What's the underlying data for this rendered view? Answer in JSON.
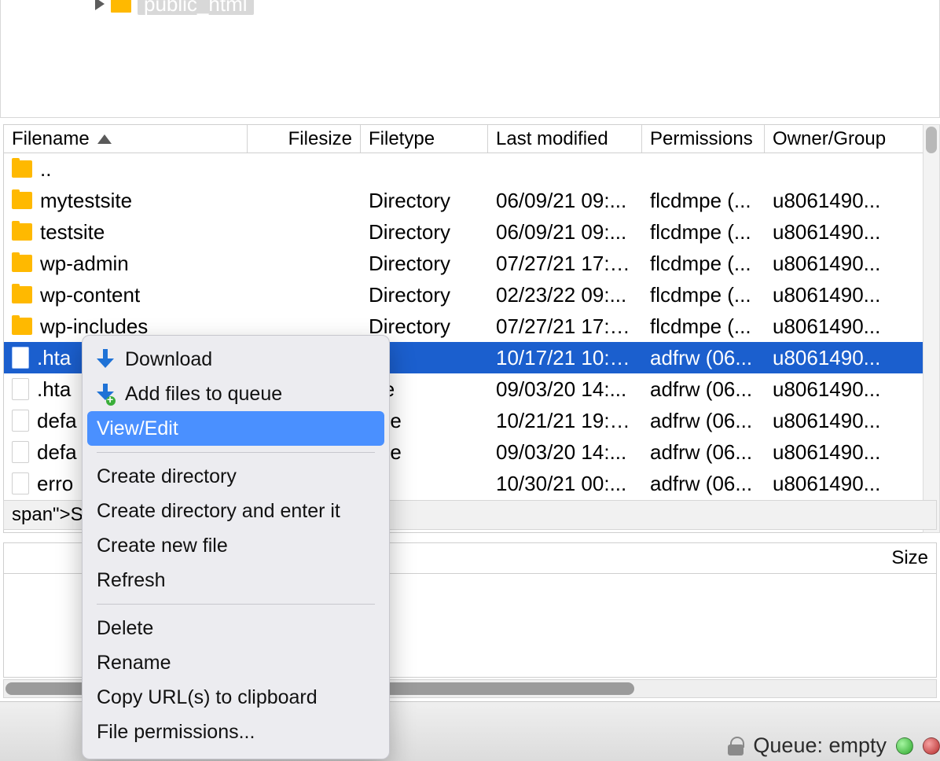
{
  "tree": {
    "selected_folder": "public_html"
  },
  "columns": {
    "filename": "Filename",
    "filesize": "Filesize",
    "filetype": "Filetype",
    "lastmod": "Last modified",
    "permissions": "Permissions",
    "owner": "Owner/Group",
    "lower_size": "Size"
  },
  "rows": [
    {
      "icon": "folder",
      "name": "..",
      "size": "",
      "type": "",
      "date": "",
      "perm": "",
      "own": "",
      "selected": false
    },
    {
      "icon": "folder",
      "name": "mytestsite",
      "size": "",
      "type": "Directory",
      "date": "06/09/21 09:...",
      "perm": "flcdmpe (...",
      "own": "u8061490...",
      "selected": false
    },
    {
      "icon": "folder",
      "name": "testsite",
      "size": "",
      "type": "Directory",
      "date": "06/09/21 09:...",
      "perm": "flcdmpe (...",
      "own": "u8061490...",
      "selected": false
    },
    {
      "icon": "folder",
      "name": "wp-admin",
      "size": "",
      "type": "Directory",
      "date": "07/27/21 17:4...",
      "perm": "flcdmpe (...",
      "own": "u8061490...",
      "selected": false
    },
    {
      "icon": "folder",
      "name": "wp-content",
      "size": "",
      "type": "Directory",
      "date": "02/23/22 09:...",
      "perm": "flcdmpe (...",
      "own": "u8061490...",
      "selected": false
    },
    {
      "icon": "folder",
      "name": "wp-includes",
      "size": "",
      "type": "Directory",
      "date": "07/27/21 17:4...",
      "perm": "flcdmpe (...",
      "own": "u8061490...",
      "selected": false
    },
    {
      "icon": "file",
      "name": ".hta",
      "size": "",
      "type": "",
      "date": "10/17/21 10:0...",
      "perm": "adfrw (06...",
      "own": "u8061490...",
      "selected": true
    },
    {
      "icon": "file",
      "name": ".hta",
      "size": "",
      "type": "file",
      "date": "09/03/20 14:...",
      "perm": "adfrw (06...",
      "own": "u8061490...",
      "selected": false
    },
    {
      "icon": "file",
      "name": "defa",
      "size": "",
      "type": "-file",
      "date": "10/21/21 19:5...",
      "perm": "adfrw (06...",
      "own": "u8061490...",
      "selected": false
    },
    {
      "icon": "file",
      "name": "defa",
      "size": "",
      "type": "-file",
      "date": "09/03/20 14:...",
      "perm": "adfrw (06...",
      "own": "u8061490...",
      "selected": false
    },
    {
      "icon": "file",
      "name": "erro",
      "size": "",
      "type": "",
      "date": "10/30/21 00:...",
      "perm": "adfrw (06...",
      "own": "u8061490...",
      "selected": false
    }
  ],
  "status": {
    "text": "Selected"
  },
  "context_menu": {
    "download": "Download",
    "add_queue": "Add files to queue",
    "view_edit": "View/Edit",
    "create_dir": "Create directory",
    "create_dir_enter": "Create directory and enter it",
    "create_file": "Create new file",
    "refresh": "Refresh",
    "delete": "Delete",
    "rename": "Rename",
    "copy_url": "Copy URL(s) to clipboard",
    "file_perms": "File permissions..."
  },
  "bottom": {
    "queue_label": "Queue: empty"
  }
}
